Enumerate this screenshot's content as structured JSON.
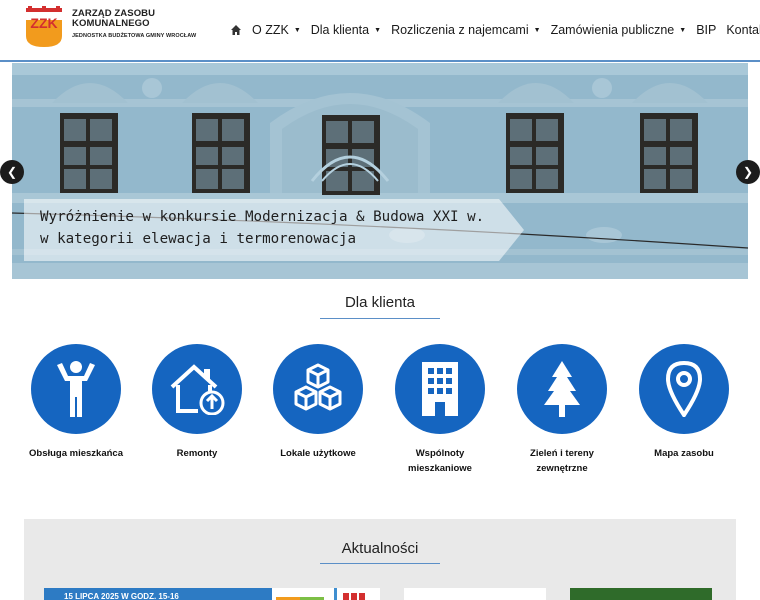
{
  "logo": {
    "mark_text": "ZZK",
    "line1": "ZARZĄD ZASOBU",
    "line2": "KOMUNALNEGO",
    "line3": "JEDNOSTKA BUDŻETOWA GMINY WROCŁAW"
  },
  "nav": {
    "items": [
      {
        "label": "O ZZK",
        "has_dropdown": true
      },
      {
        "label": "Dla klienta",
        "has_dropdown": true
      },
      {
        "label": "Rozliczenia z najemcami",
        "has_dropdown": true
      },
      {
        "label": "Zamówienia publiczne",
        "has_dropdown": true
      },
      {
        "label": "BIP",
        "has_dropdown": false
      },
      {
        "label": "Kontakt",
        "has_dropdown": false
      }
    ]
  },
  "hero": {
    "caption_line1": "Wyróżnienie w konkursie Modernizacja & Budowa XXI w.",
    "caption_line2": "w kategorii elewacja i termorenowacja"
  },
  "client_section": {
    "title": "Dla klienta",
    "items": [
      {
        "label": "Obsługa mieszkańca",
        "icon": "person-icon"
      },
      {
        "label": "Remonty",
        "icon": "house-upload-icon"
      },
      {
        "label": "Lokale użytkowe",
        "icon": "cubes-icon"
      },
      {
        "label": "Wspólnoty mieszkaniowe",
        "icon": "building-icon"
      },
      {
        "label": "Zieleń i tereny zewnętrzne",
        "icon": "tree-icon"
      },
      {
        "label": "Mapa zasobu",
        "icon": "map-pin-icon"
      }
    ]
  },
  "news": {
    "title": "Aktualności",
    "card1_text": "15 LIPCA 2025 W GODZ. 15-16"
  },
  "colors": {
    "brand_blue": "#1565c0",
    "accent_line": "#5b8fc7",
    "logo_red": "#d32f2f",
    "logo_orange": "#f29b1d"
  }
}
